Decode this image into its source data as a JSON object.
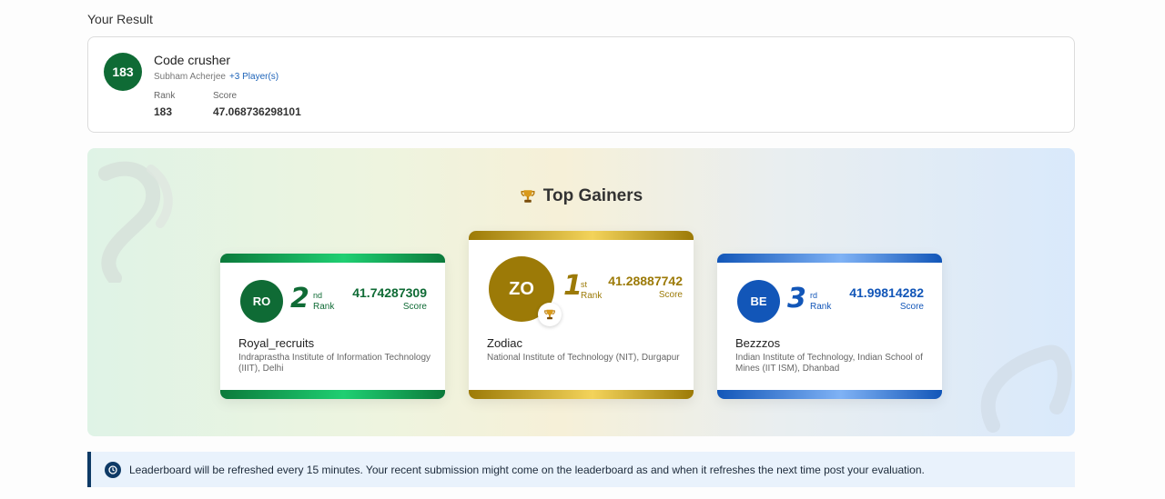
{
  "section_title": "Your Result",
  "result": {
    "badge": "183",
    "team_name": "Code crusher",
    "player": "Subham Acherjee",
    "more_players": "+3 Player(s)",
    "rank_label": "Rank",
    "rank_value": "183",
    "score_label": "Score",
    "score_value": "47.068736298101"
  },
  "top_gainers": {
    "title": "Top Gainers",
    "cards": [
      {
        "initials": "RO",
        "rank_number": "2",
        "rank_suffix": "nd",
        "rank_word": "Rank",
        "score": "41.74287309",
        "score_label": "Score",
        "name": "Royal_recruits",
        "institute": "Indraprastha Institute of Information Technology (IIIT), Delhi",
        "color": "#0f6b35"
      },
      {
        "initials": "ZO",
        "rank_number": "1",
        "rank_suffix": "st",
        "rank_word": "Rank",
        "score": "41.28887742",
        "score_label": "Score",
        "name": "Zodiac",
        "institute": "National Institute of Technology (NIT), Durgapur",
        "color": "#9c7a07"
      },
      {
        "initials": "BE",
        "rank_number": "3",
        "rank_suffix": "rd",
        "rank_word": "Rank",
        "score": "41.99814282",
        "score_label": "Score",
        "name": "Bezzzos",
        "institute": "Indian Institute of Technology, Indian School of Mines (IIT ISM), Dhanbad",
        "color": "#1256b8"
      }
    ]
  },
  "notice": {
    "icon": "info-icon",
    "text": "Leaderboard will be refreshed every 15 minutes. Your recent submission might come on the leaderboard as and when it refreshes the next time post your evaluation."
  }
}
